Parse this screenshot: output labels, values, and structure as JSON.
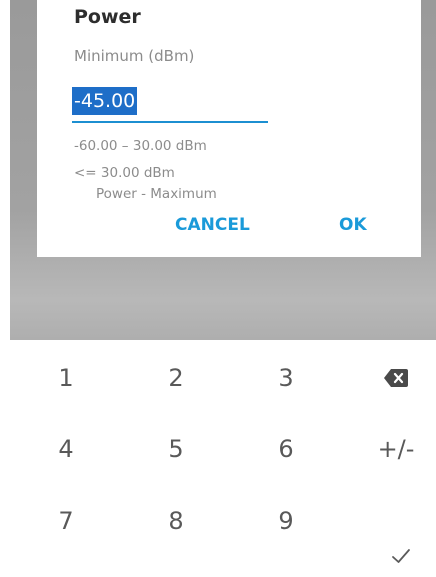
{
  "dialog": {
    "title": "Power",
    "subtitle": "Minimum (dBm)",
    "input_value": "-45.00",
    "range_text": "-60.00 – 30.00 dBm",
    "limit_text": "<= 30.00 dBm",
    "limit_name": "Power - Maximum",
    "cancel_label": "CANCEL",
    "ok_label": "OK"
  },
  "keypad": {
    "keys": [
      "1",
      "2",
      "3",
      "4",
      "5",
      "6",
      "+/-",
      "7",
      "8",
      "9"
    ],
    "backspace_icon": "backspace-icon",
    "done_icon": "check-icon"
  },
  "colors": {
    "accent": "#1a9ad9",
    "selection": "#1e6ec8",
    "scrim": "#a2a2a2"
  }
}
